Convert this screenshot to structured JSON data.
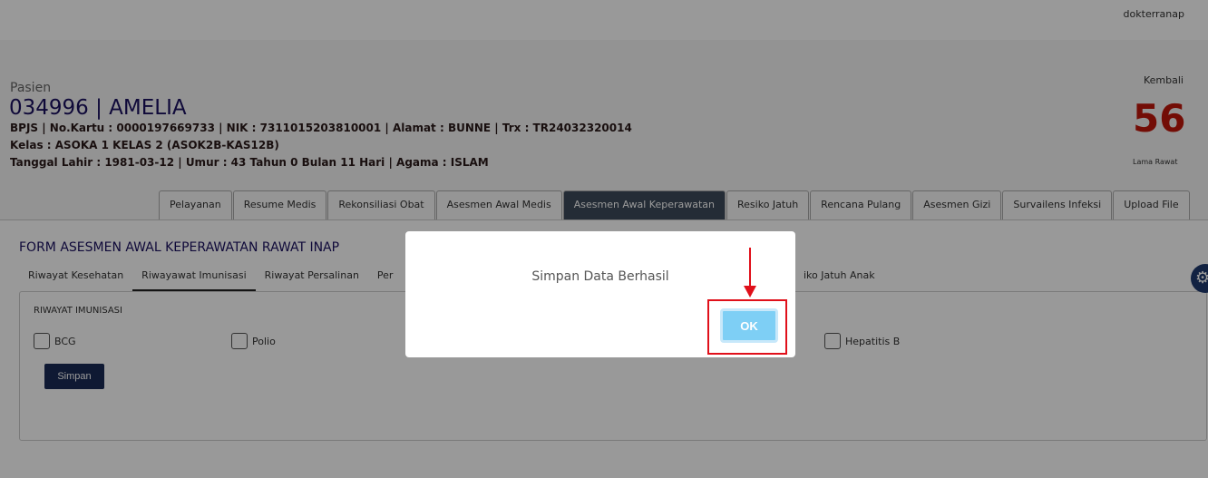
{
  "header": {
    "user": "dokterranap"
  },
  "patient": {
    "label": "Pasien",
    "name": "034996 | AMELIA",
    "line1": "BPJS | No.Kartu : 0000197669733 | NIK : 7311015203810001 | Alamat : BUNNE | Trx : TR24032320014",
    "line2": "Kelas : ASOKA 1 KELAS 2 (ASOK2B-KAS12B)",
    "line3": "Tanggal Lahir : 1981-03-12 | Umur : 43 Tahun 0 Bulan 11 Hari | Agama : ISLAM"
  },
  "side": {
    "back": "Kembali",
    "days": "56",
    "days_label": "Lama Rawat"
  },
  "tabs": [
    "Pelayanan",
    "Resume Medis",
    "Rekonsiliasi Obat",
    "Asesmen Awal Medis",
    "Asesmen Awal Keperawatan",
    "Resiko Jatuh",
    "Rencana Pulang",
    "Asesmen Gizi",
    "Survailens Infeksi",
    "Upload File"
  ],
  "form": {
    "title": "FORM ASESMEN AWAL KEPERAWATAN RAWAT INAP",
    "subtabs": [
      "Riwayat Kesehatan",
      "Riwayawat Imunisasi",
      "Riwayat Persalinan",
      "Per"
    ],
    "subtab_extra": "iko Jatuh Anak",
    "card_title": "RIWAYAT IMUNISASI",
    "checkboxes": [
      "BCG",
      "Polio",
      "Hepatitis B"
    ],
    "save": "Simpan"
  },
  "modal": {
    "message": "Simpan Data Berhasil",
    "ok": "OK"
  },
  "colors": {
    "accent": "#1a2a55",
    "active_tab": "#3d4a5a",
    "highlight": "#e0101a",
    "days": "#c0160a"
  }
}
